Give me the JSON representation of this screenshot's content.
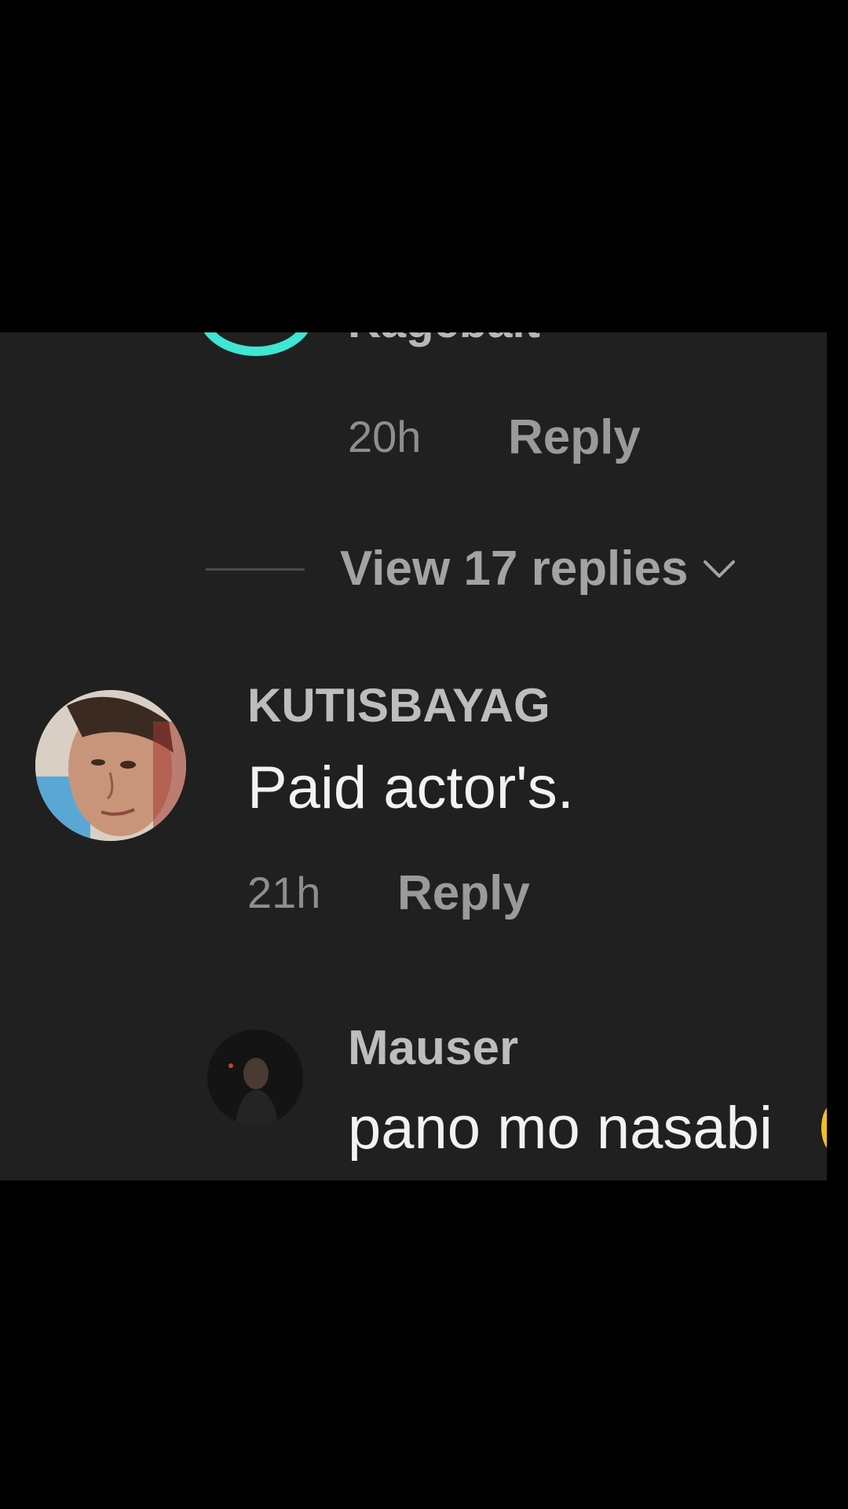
{
  "comments": {
    "previous": {
      "username_partial": "Kagebait",
      "time": "20h",
      "reply_label": "Reply",
      "avatar_ring_color": "#3ee6d3"
    },
    "view_replies": {
      "label": "View 17 replies",
      "icon": "chevron-down-icon"
    },
    "kutisbayag": {
      "username": "KUTISBAYAG",
      "text": "Paid actor's.",
      "time": "21h",
      "reply_label": "Reply"
    },
    "mauser": {
      "username": "Mauser",
      "text": "pano mo nasabi"
    }
  },
  "colors": {
    "panel_bg": "#202020",
    "outer_bg": "#000000",
    "accent_teal": "#3ee6d3",
    "text_primary": "#f2f2f2",
    "text_secondary": "#9a9a9a"
  }
}
